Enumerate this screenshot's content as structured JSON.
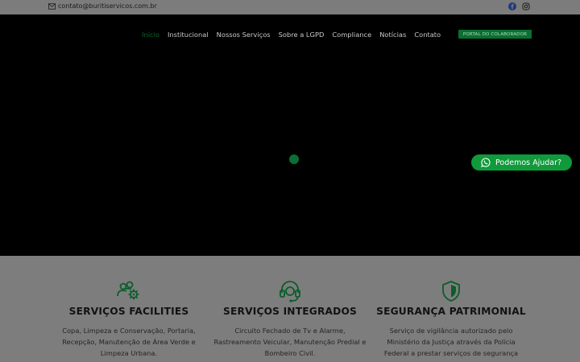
{
  "topbar": {
    "email": "contato@buritiservicos.com.br"
  },
  "social": {
    "facebook_icon": "facebook-icon",
    "instagram_icon": "instagram-icon"
  },
  "nav": {
    "items": [
      "Início",
      "Institucional",
      "Nossos Serviços",
      "Sobre a LGPD",
      "Compliance",
      "Notícias",
      "Contato"
    ],
    "active_index": 0,
    "portal_button": "PORTAL DO COLABORADOR"
  },
  "whatsapp": {
    "label": "Podemos Ajudar?"
  },
  "services": [
    {
      "title": "SERVIÇOS FACILITIES",
      "text": "Copa, Limpeza e Conservação, Portaria, Recepção, Manutenção de Área Verde e Limpeza Urbana.",
      "icon": "team-gear-icon"
    },
    {
      "title": "SERVIÇOS INTEGRADOS",
      "text": "Circuito Fechado de Tv   e Alarme, Rastreamento   Veicular, Manutenção Predial e Bombeiro Civil.",
      "icon": "headset-icon"
    },
    {
      "title": "SEGURANÇA PATRIMONIAL",
      "text": "Serviço de vigilância autorizado pelo Ministério da Justiça através da Polícia Federal a prestar serviços de segurança",
      "icon": "shield-icon"
    }
  ],
  "colors": {
    "accent": "#0b6e33",
    "whatsapp": "#109a3b",
    "overlay": "#7d7d7d"
  }
}
